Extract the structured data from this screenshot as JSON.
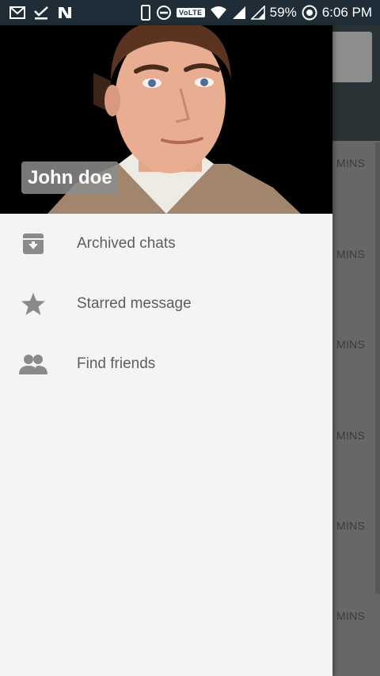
{
  "status_bar": {
    "left_icons": [
      "gmail-icon",
      "task-check-icon",
      "n-app-icon"
    ],
    "volte_label": "VoLTE",
    "battery_percent": "59%",
    "time": "6:06 PM"
  },
  "background_list": {
    "time_labels": [
      "MINS",
      "MINS",
      "MINS",
      "MINS",
      "MINS",
      "MINS"
    ]
  },
  "drawer": {
    "user_name": "John doe",
    "items": [
      {
        "label": "Archived chats",
        "icon": "archive-icon"
      },
      {
        "label": "Starred message",
        "icon": "star-icon"
      },
      {
        "label": "Find friends",
        "icon": "people-icon"
      }
    ]
  },
  "colors": {
    "status_bar": "#1e2d37",
    "drawer_bg": "#f4f4f4",
    "menu_text": "#5e5e5e",
    "icon_gray": "#8a8a8a",
    "scrim": "#676767"
  }
}
